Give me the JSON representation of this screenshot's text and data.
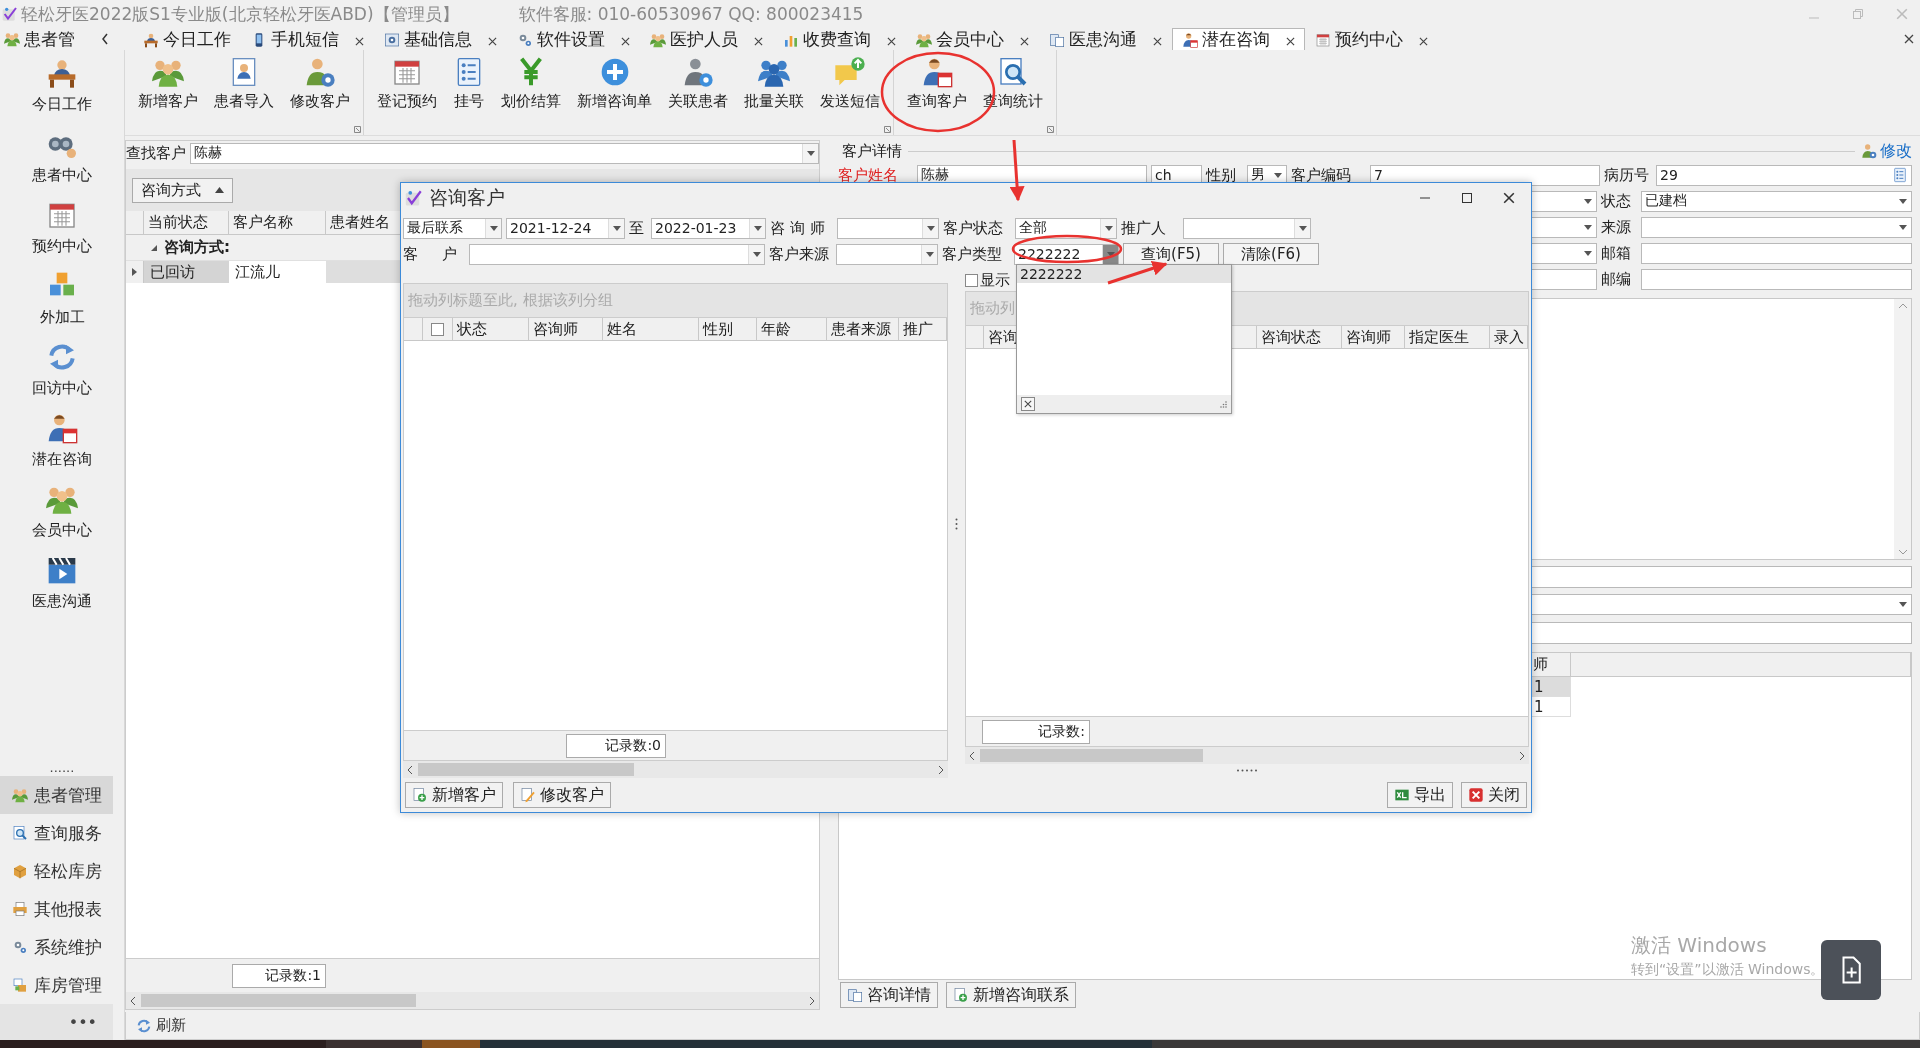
{
  "app": {
    "title": "轻松牙医2022版S1专业版(北京轻松牙医ABD)【管理员】",
    "service": "软件客服: 010-60530967  QQ: 800023415"
  },
  "nav_header": {
    "label": "患者管"
  },
  "tabs": [
    {
      "label": "今日工作",
      "closable": false,
      "selected": false
    },
    {
      "label": "手机短信",
      "closable": true,
      "selected": false
    },
    {
      "label": "基础信息",
      "closable": true,
      "selected": false
    },
    {
      "label": "软件设置",
      "closable": true,
      "selected": false
    },
    {
      "label": "医护人员",
      "closable": true,
      "selected": false
    },
    {
      "label": "收费查询",
      "closable": true,
      "selected": false
    },
    {
      "label": "会员中心",
      "closable": true,
      "selected": false
    },
    {
      "label": "医患沟通",
      "closable": true,
      "selected": false
    },
    {
      "label": "潜在咨询",
      "closable": true,
      "selected": true
    },
    {
      "label": "预约中心",
      "closable": true,
      "selected": false
    }
  ],
  "ribbon": {
    "groups": [
      {
        "buttons": [
          "新增客户",
          "患者导入",
          "修改客户"
        ]
      },
      {
        "buttons": [
          "登记预约",
          "挂号",
          "划价结算",
          "新增咨询单",
          "关联患者",
          "批量关联",
          "发送短信"
        ]
      },
      {
        "buttons": [
          "查询客户",
          "查询统计"
        ]
      }
    ]
  },
  "sidebar": {
    "items": [
      {
        "label": "今日工作",
        "selected": false
      },
      {
        "label": "患者中心",
        "selected": false
      },
      {
        "label": "预约中心",
        "selected": false
      },
      {
        "label": "外加工",
        "selected": false
      },
      {
        "label": "回访中心",
        "selected": false
      },
      {
        "label": "潜在咨询",
        "selected": false
      },
      {
        "label": "会员中心",
        "selected": false
      },
      {
        "label": "医患沟通",
        "selected": false
      }
    ],
    "more_dots": "......",
    "nav": [
      {
        "label": "患者管理",
        "selected": true
      },
      {
        "label": "查询服务",
        "selected": false
      },
      {
        "label": "轻松库房",
        "selected": false
      },
      {
        "label": "其他报表",
        "selected": false
      },
      {
        "label": "系统维护",
        "selected": false
      },
      {
        "label": "库房管理",
        "selected": false
      }
    ],
    "overflow": "•••"
  },
  "customer_list": {
    "search_label": "查找客户",
    "search_value": "陈赫",
    "group_chip": "咨询方式",
    "columns": [
      "当前状态",
      "客户名称",
      "患者姓名"
    ],
    "groups": [
      {
        "label": "咨询方式:",
        "expanded": true,
        "rows": [
          [
            "已回访",
            "江流儿"
          ]
        ]
      }
    ],
    "record_count": "记录数:1"
  },
  "details": {
    "title": "客户详情",
    "edit_link": "修改",
    "name_label": "客户姓名",
    "name_value": "陈赫",
    "pinyin": "ch",
    "gender_label": "性别",
    "gender_value": "男",
    "code_label": "客户编码",
    "code_value": "7",
    "record_label": "病历号",
    "record_value": "29",
    "side_fields": [
      {
        "label": "状态",
        "value": "已建档"
      },
      {
        "label": "来源"
      },
      {
        "label": "邮箱"
      },
      {
        "label": "邮编"
      }
    ],
    "contacts": {
      "columns": [
        "师"
      ],
      "rows": [
        [
          "1"
        ],
        [
          "1"
        ]
      ]
    },
    "buttons": [
      "咨询详情",
      "新增咨询联系"
    ]
  },
  "status_bar": {
    "refresh": "刷新"
  },
  "dialog": {
    "title": "咨询客户",
    "date_mode": "最后联系",
    "date_from": "2021-12-24",
    "to": "至",
    "date_to": "2022-01-23",
    "consultant_label": "咨 询 师",
    "status_label": "客户状态",
    "status_value": "全部",
    "promoter_label": "推广人",
    "customer_label": "客     户",
    "source_label": "客户来源",
    "type_label": "客户类型",
    "type_value": "2222222",
    "query_button": "查询(F5)",
    "clear_button": "清除(F6)",
    "show_checkbox": {
      "label": "显示",
      "checked": false
    },
    "left_grid": {
      "group_hint": "拖动列标题至此, 根据该列分组",
      "header_checked": false,
      "columns": [
        "状态",
        "咨询师",
        "姓名",
        "性别",
        "年龄",
        "患者来源",
        "推广"
      ],
      "record_count": "记录数:0"
    },
    "right_grid": {
      "group_hint": "拖动列",
      "columns": [
        "咨询",
        "咨询状态",
        "咨询师",
        "指定医生",
        "录入"
      ],
      "record_count": "记录数:"
    },
    "buttons_left": [
      "新增客户",
      "修改客户"
    ],
    "buttons_right": [
      "导出",
      "关闭"
    ],
    "type_dropdown": {
      "items": [
        {
          "label": "2222222",
          "selected": true
        }
      ]
    }
  },
  "watermark": {
    "line1": "激活 Windows",
    "line2": "转到“设置”以激活 Windows。"
  }
}
